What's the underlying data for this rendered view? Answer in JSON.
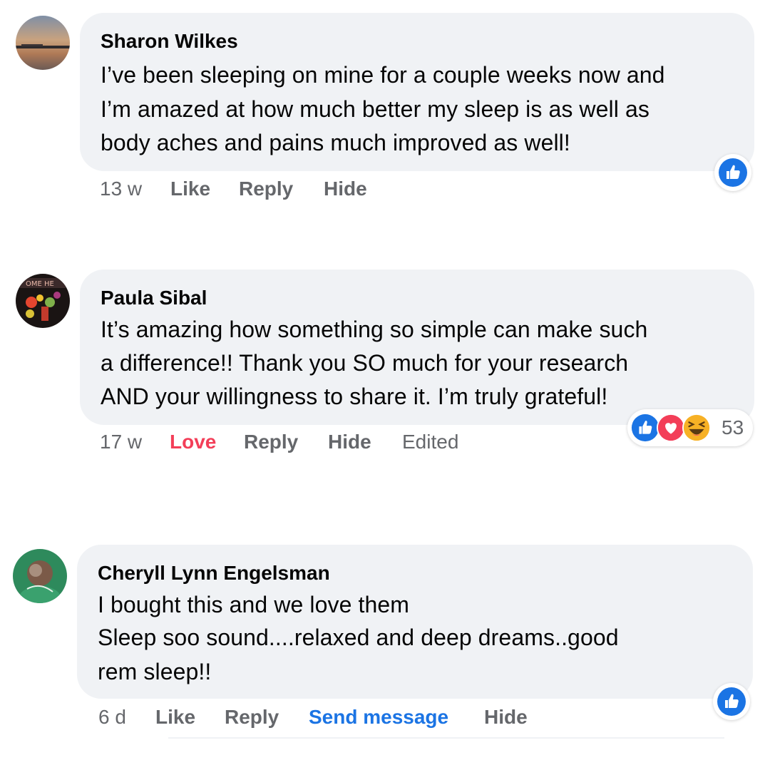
{
  "comments": [
    {
      "author": "Sharon Wilkes",
      "lines": [
        "I’ve been sleeping on mine for a couple weeks now and",
        "I’m amazed at how much better my sleep is as well as",
        "body aches and pains much improved as well!"
      ],
      "time": "13 w",
      "actions": {
        "like": "Like",
        "reply": "Reply",
        "hide": "Hide"
      },
      "reaction": "like-icon"
    },
    {
      "author": "Paula Sibal",
      "lines": [
        "It’s amazing how something so simple can make such",
        "a difference!! Thank you SO much for your research",
        "AND your willingness to share it. I’m truly grateful!"
      ],
      "time": "17 w",
      "actions": {
        "love": "Love",
        "reply": "Reply",
        "hide": "Hide",
        "edited": "Edited"
      },
      "reactions": [
        "like-icon",
        "love-icon",
        "haha-icon"
      ],
      "reaction_count": "53",
      "colors": {
        "love": "#f33e58"
      }
    },
    {
      "author": "Cheryll Lynn Engelsman",
      "lines": [
        "I bought this and we love them",
        "Sleep soo sound....relaxed and deep dreams..good",
        "rem sleep!!"
      ],
      "time": "6 d",
      "actions": {
        "like": "Like",
        "reply": "Reply",
        "send_message": "Send message",
        "hide": "Hide"
      },
      "reaction": "like-icon",
      "colors": {
        "send_message": "#1b74e4"
      }
    }
  ],
  "colors": {
    "bubble": "#f0f2f5",
    "secondary_text": "#65676b",
    "like_blue": "#1b74e4"
  }
}
